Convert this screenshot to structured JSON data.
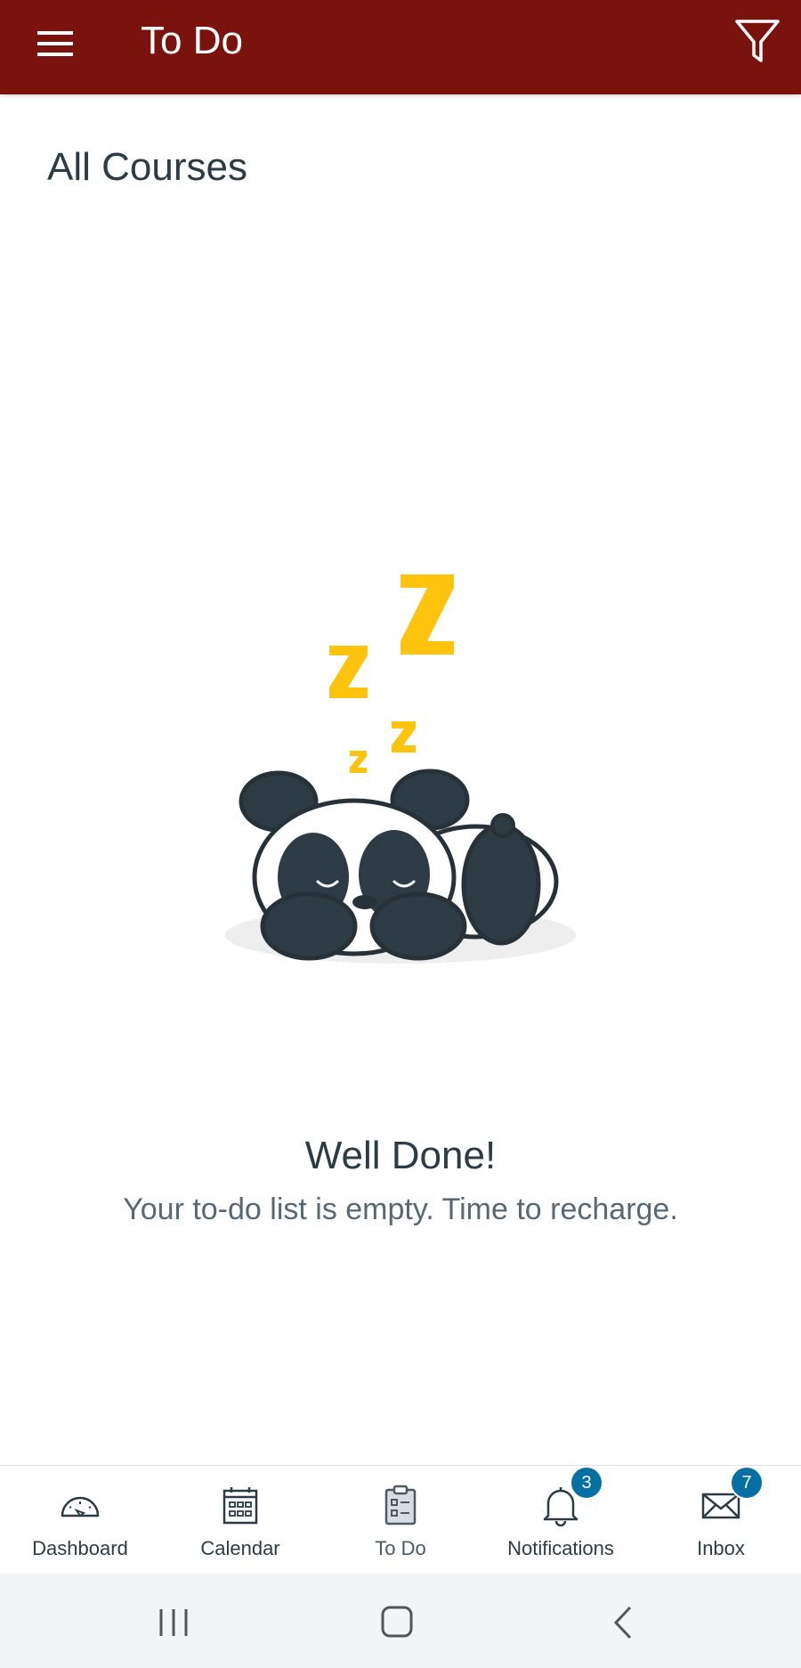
{
  "header": {
    "title": "To Do",
    "background_color": "#7a130e",
    "menu_icon": "hamburger-menu-icon",
    "filter_icon": "filter-icon"
  },
  "course_filter": {
    "label": "All Courses"
  },
  "empty_state": {
    "illustration": "sleeping-panda",
    "title": "Well Done!",
    "message": "Your to-do list is empty. Time to recharge."
  },
  "bottom_nav": {
    "active": "To Do",
    "items": [
      {
        "label": "Dashboard",
        "icon": "dashboard-gauge-icon"
      },
      {
        "label": "Calendar",
        "icon": "calendar-icon"
      },
      {
        "label": "To Do",
        "icon": "clipboard-icon"
      },
      {
        "label": "Notifications",
        "icon": "bell-icon",
        "badge": "3"
      },
      {
        "label": "Inbox",
        "icon": "envelope-icon",
        "badge": "7"
      }
    ],
    "badge_color": "#0770a3"
  },
  "system_nav": {
    "buttons": [
      "recent-apps-icon",
      "home-icon",
      "back-icon"
    ]
  }
}
